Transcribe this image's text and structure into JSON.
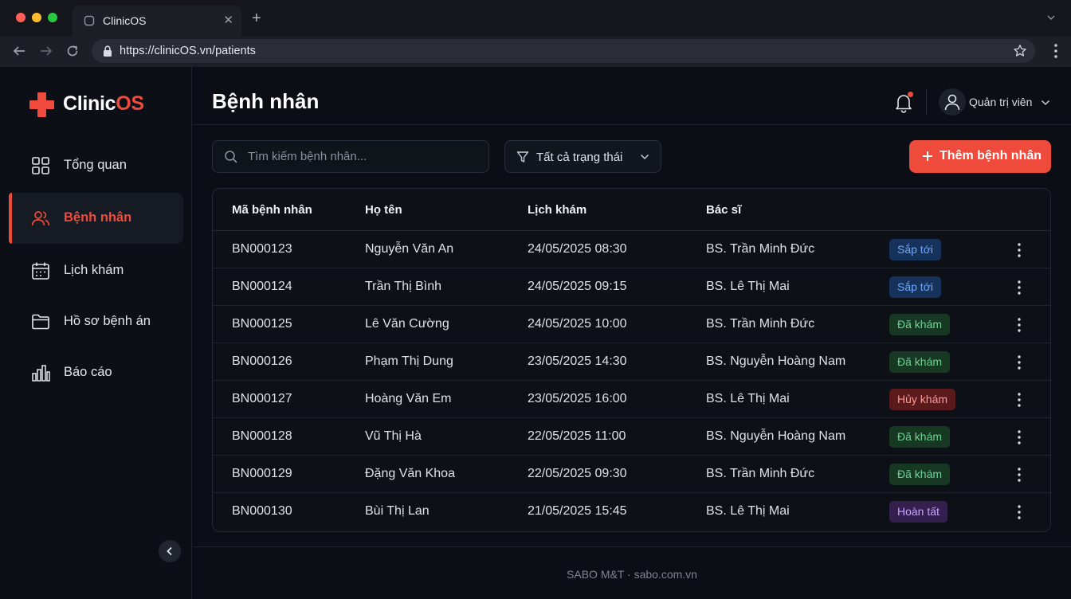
{
  "browser": {
    "tab_title": "ClinicOS",
    "url": "https://clinicOS.vn/patients"
  },
  "brand": {
    "name_main": "Clinic",
    "name_accent": "OS",
    "accent_color": "#ef4b3c"
  },
  "sidebar": {
    "items": [
      {
        "label": "Tổng quan",
        "icon": "dashboard-icon",
        "active": false
      },
      {
        "label": "Bệnh nhân",
        "icon": "users-icon",
        "active": true
      },
      {
        "label": "Lịch khám",
        "icon": "calendar-icon",
        "active": false
      },
      {
        "label": "Hồ sơ bệnh án",
        "icon": "folder-icon",
        "active": false
      },
      {
        "label": "Báo cáo",
        "icon": "bar-chart-icon",
        "active": false
      }
    ]
  },
  "header": {
    "title": "Bệnh nhân",
    "user_name": "Quản trị viên"
  },
  "toolbar": {
    "search_placeholder": "Tìm kiếm bệnh nhân...",
    "filter_label": "Tất cả trạng thái",
    "add_label": "Thêm bệnh nhân"
  },
  "table": {
    "columns": [
      "Mã bệnh nhân",
      "Họ tên",
      "Lịch khám",
      "Bác sĩ"
    ],
    "rows": [
      {
        "id": "BN000123",
        "name": "Nguyễn Văn An",
        "schedule": "24/05/2025 08:30",
        "doctor": "BS. Trần Minh Đức",
        "status": "Sắp tới",
        "status_type": "upcoming"
      },
      {
        "id": "BN000124",
        "name": "Trần Thị Bình",
        "schedule": "24/05/2025 09:15",
        "doctor": "BS. Lê Thị Mai",
        "status": "Sắp tới",
        "status_type": "upcoming"
      },
      {
        "id": "BN000125",
        "name": "Lê Văn Cường",
        "schedule": "24/05/2025 10:00",
        "doctor": "BS. Trần Minh Đức",
        "status": "Đã khám",
        "status_type": "done"
      },
      {
        "id": "BN000126",
        "name": "Phạm Thị Dung",
        "schedule": "23/05/2025 14:30",
        "doctor": "BS. Nguyễn Hoàng Nam",
        "status": "Đã khám",
        "status_type": "done"
      },
      {
        "id": "BN000127",
        "name": "Hoàng Văn Em",
        "schedule": "23/05/2025 16:00",
        "doctor": "BS. Lê Thị Mai",
        "status": "Hủy khám",
        "status_type": "cancel"
      },
      {
        "id": "BN000128",
        "name": "Vũ Thị Hà",
        "schedule": "22/05/2025 11:00",
        "doctor": "BS. Nguyễn Hoàng Nam",
        "status": "Đã khám",
        "status_type": "done"
      },
      {
        "id": "BN000129",
        "name": "Đặng Văn Khoa",
        "schedule": "22/05/2025 09:30",
        "doctor": "BS. Trần Minh Đức",
        "status": "Đã khám",
        "status_type": "done"
      },
      {
        "id": "BN000130",
        "name": "Bùi Thị Lan",
        "schedule": "21/05/2025 15:45",
        "doctor": "BS. Lê Thị Mai",
        "status": "Hoàn tất",
        "status_type": "complete"
      }
    ]
  },
  "footer": {
    "text": "SABO M&T · sabo.com.vn"
  }
}
